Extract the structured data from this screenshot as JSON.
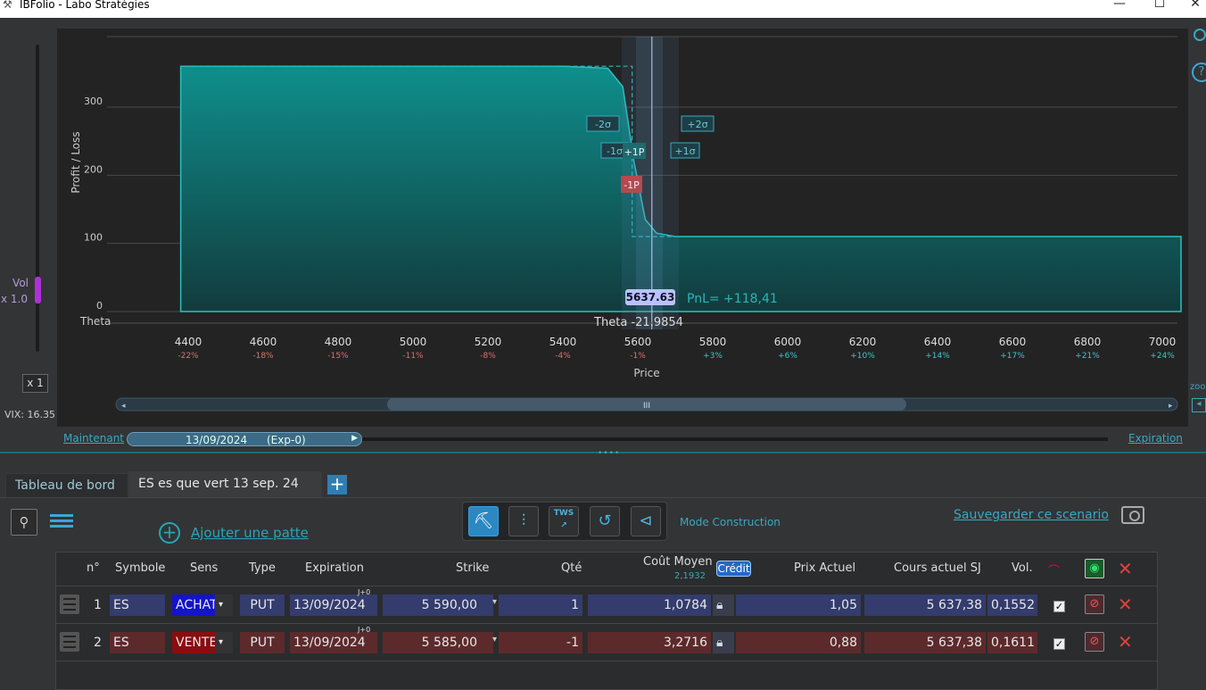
{
  "window": {
    "title": "IBFolio - Labo Stratégies",
    "minimize": "—",
    "maximize": "☐",
    "close": "✕"
  },
  "left_panel": {
    "vol_label": "Vol",
    "vol_mult": "x 1.0",
    "x1_button": "x 1",
    "vix": "VIX: 16.35"
  },
  "chart": {
    "ylabel": "Profit / Loss",
    "xlabel": "Price",
    "y_ticks": [
      "300",
      "200",
      "100",
      "0"
    ],
    "x_ticks": [
      "4400",
      "4600",
      "4800",
      "5000",
      "5200",
      "5400",
      "5600",
      "5800",
      "6000",
      "6200",
      "6400",
      "6600",
      "6800",
      "7000"
    ],
    "x_pct": [
      "-22%",
      "-18%",
      "-15%",
      "-11%",
      "-8%",
      "-4%",
      "-1%",
      "+3%",
      "+6%",
      "+10%",
      "+14%",
      "+17%",
      "+21%",
      "+24%"
    ],
    "theta_label": "Theta",
    "theta_value": "Theta -21.9854",
    "current_price": "5637.63",
    "pnl": "PnL= +118,41",
    "markers": {
      "m2s": "-2σ",
      "p2s": "+2σ",
      "m1s": "-1σ",
      "p1s": "+1σ",
      "p1p": "+1P",
      "m1p": "-1P"
    },
    "scroll_grip": "III",
    "chart_data": {
      "type": "area",
      "xlabel": "Price",
      "ylabel": "Profit / Loss",
      "xlim": [
        4300,
        7050
      ],
      "ylim": [
        -20,
        400
      ],
      "x": [
        4380,
        5400,
        5520,
        5560,
        5590,
        5620,
        5650,
        5700,
        7050
      ],
      "y": [
        360,
        360,
        357,
        330,
        220,
        135,
        115,
        110,
        110
      ]
    }
  },
  "timeline": {
    "now": "Maintenant",
    "date": "13/09/2024",
    "exp": "(Exp-0)",
    "expiration": "Expiration"
  },
  "tabs": [
    {
      "label": "Tableau de bord"
    },
    {
      "label": "ES es que vert 13 sep. 24"
    }
  ],
  "add_tab": "+",
  "toolbar": {
    "add_leg": "Ajouter une patte",
    "mode": "Mode Construction",
    "save": "Sauvegarder ce scenario",
    "tws": "TWS"
  },
  "grid": {
    "headers": {
      "n": "n°",
      "symbol": "Symbole",
      "sens": "Sens",
      "type": "Type",
      "expiration": "Expiration",
      "strike": "Strike",
      "qty": "Qté",
      "cost": "Coût Moyen",
      "cost_sub": "2,1932",
      "credit": "Crédit",
      "price": "Prix Actuel",
      "underlying": "Cours actuel SJ",
      "vol": "Vol."
    },
    "rows": [
      {
        "n": "1",
        "symbol": "ES",
        "sens": "ACHAT",
        "type": "PUT",
        "exp": "13/09/2024",
        "dte": "J+0",
        "strike": "5 590,00",
        "qty": "1",
        "cost": "1,0784",
        "price": "1,05",
        "underlying": "5 637,38",
        "vol": "0,1552"
      },
      {
        "n": "2",
        "symbol": "ES",
        "sens": "VENTE",
        "type": "PUT",
        "exp": "13/09/2024",
        "dte": "J+0",
        "strike": "5 585,00",
        "qty": "-1",
        "cost": "3,2716",
        "price": "0,88",
        "underlying": "5 637,38",
        "vol": "0,1611"
      }
    ]
  },
  "side": {
    "help": "?",
    "zoom": "zoo"
  }
}
